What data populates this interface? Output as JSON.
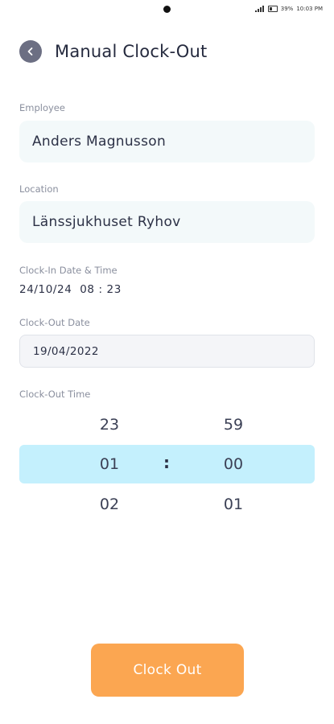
{
  "status_bar": {
    "battery": "39%",
    "time": "10:03 PM"
  },
  "header": {
    "title": "Manual Clock-Out"
  },
  "employee": {
    "label": "Employee",
    "value": "Anders Magnusson"
  },
  "location": {
    "label": "Location",
    "value": "Länssjukhuset Ryhov"
  },
  "clock_in": {
    "label": "Clock-In Date & Time",
    "value": "24/10/24  08 : 23"
  },
  "clock_out_date": {
    "label": "Clock-Out Date",
    "value": "19/04/2022"
  },
  "clock_out_time": {
    "label": "Clock-Out Time",
    "hours": {
      "prev": "23",
      "selected": "01",
      "next": "02"
    },
    "minutes": {
      "prev": "59",
      "selected": "00",
      "next": "01"
    },
    "separator": ":"
  },
  "actions": {
    "clock_out_label": "Clock Out"
  },
  "colors": {
    "accent_button": "#fba651",
    "picker_highlight": "#c4f0fd",
    "back_button": "#6c6f83"
  }
}
